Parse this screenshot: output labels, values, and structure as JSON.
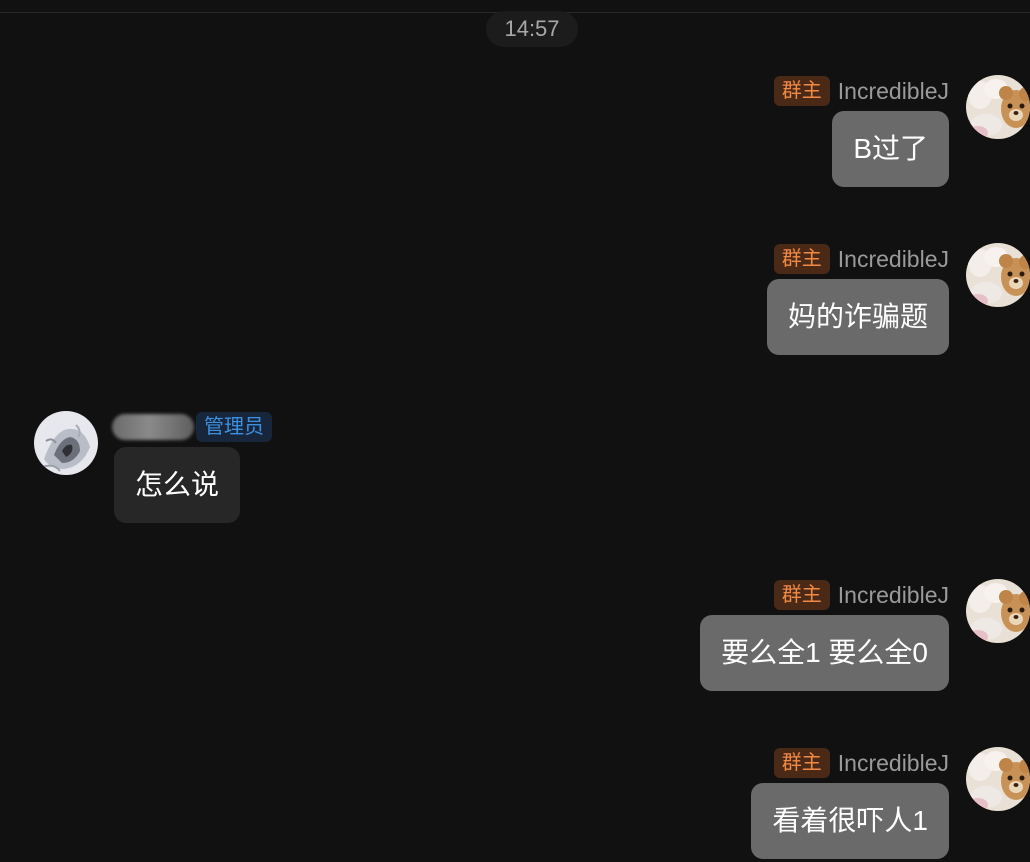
{
  "time_label": "14:57",
  "messages": [
    {
      "side": "right",
      "role_badge": "群主",
      "sender": "IncredibleJ",
      "text": "B过了",
      "avatar": "teddy-bear-avatar"
    },
    {
      "side": "right",
      "role_badge": "群主",
      "sender": "IncredibleJ",
      "text": "妈的诈骗题",
      "avatar": "teddy-bear-avatar"
    },
    {
      "side": "left",
      "role_badge": "管理员",
      "sender": "",
      "text": "怎么说",
      "avatar": "monochrome-avatar"
    },
    {
      "side": "right",
      "role_badge": "群主",
      "sender": "IncredibleJ",
      "text": "要么全1 要么全0",
      "avatar": "teddy-bear-avatar"
    },
    {
      "side": "right",
      "role_badge": "群主",
      "sender": "IncredibleJ",
      "text": "看着很吓人1",
      "avatar": "teddy-bear-avatar"
    }
  ],
  "colors": {
    "background": "#111111",
    "owner_badge_text": "#f08a45",
    "owner_badge_bg": "#4a2a17",
    "admin_badge_text": "#3d8fe0",
    "admin_badge_bg": "#17263b",
    "my_bubble": "#6a6a6a",
    "other_bubble": "#272727"
  }
}
